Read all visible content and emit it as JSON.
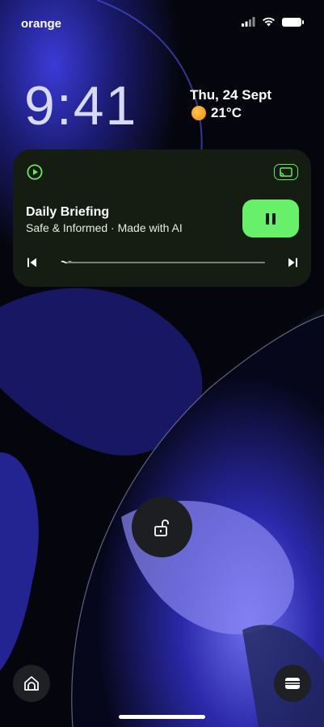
{
  "status_bar": {
    "carrier": "orange",
    "icons": [
      "signal-icon",
      "wifi-icon",
      "battery-icon"
    ]
  },
  "lockscreen": {
    "time": "9:41",
    "date": "Thu, 24 Sept",
    "weather": {
      "icon": "sun-icon",
      "temperature": "21°C"
    }
  },
  "media_player": {
    "app_icon": "play-circle-icon",
    "output_icon": "cast-icon",
    "title": "Daily Briefing",
    "subtitle": "Safe & Informed · Made with AI",
    "state": "playing",
    "control_icon": "pause-icon",
    "progress_fraction": 0.02,
    "accent_color": "#69f06a",
    "card_color": "#151c11"
  },
  "unlock": {
    "icon": "unlock-icon"
  },
  "shortcuts": {
    "left_icon": "home-icon",
    "right_icon": "wallet-icon"
  },
  "colors": {
    "background": "#05060d",
    "wallpaper_accent": "#2f2fd0"
  }
}
